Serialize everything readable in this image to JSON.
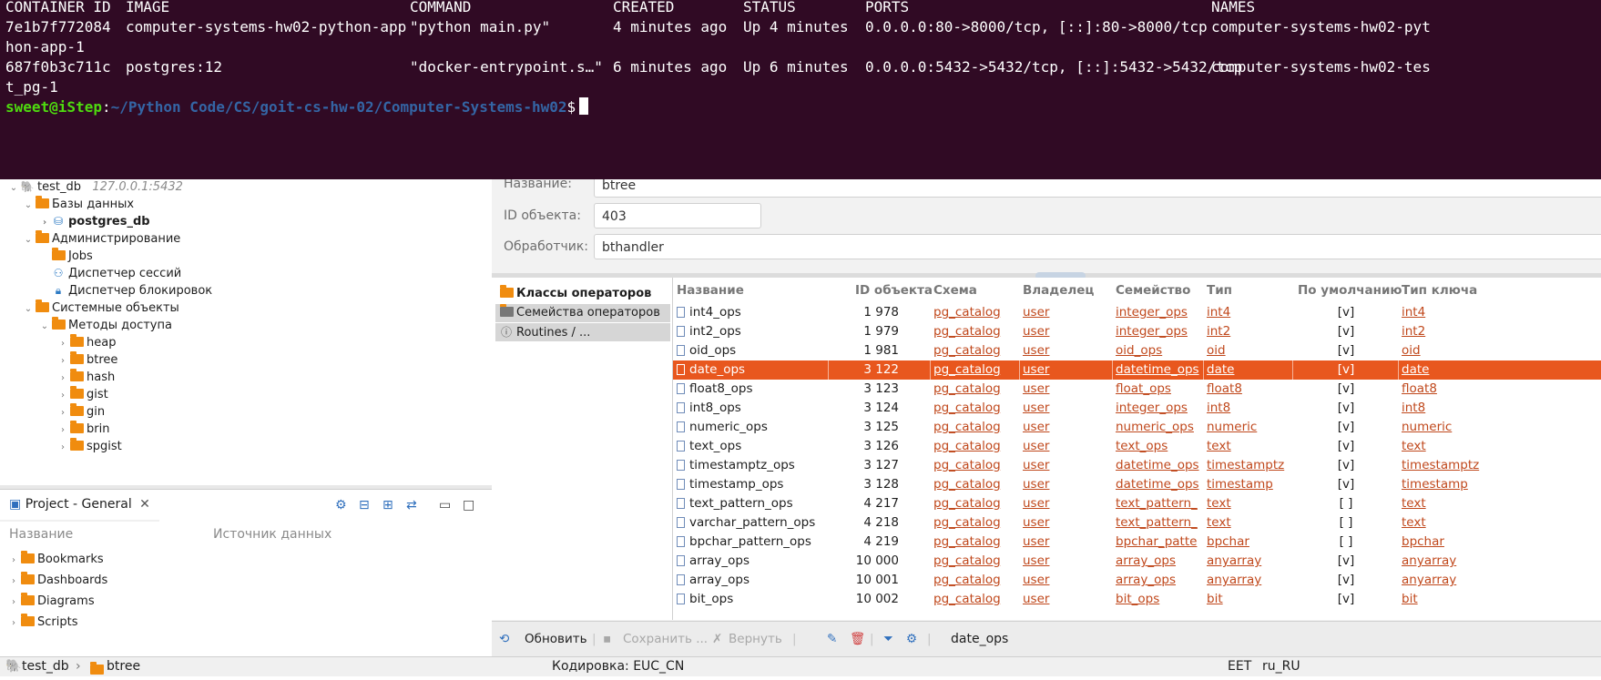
{
  "terminal": {
    "headers": {
      "container_id": "CONTAINER ID",
      "image": "IMAGE",
      "command": "COMMAND",
      "created": "CREATED",
      "status": "STATUS",
      "ports": "PORTS",
      "names": "NAMES"
    },
    "rows": [
      {
        "container_id": "7e1b7f772084",
        "image": "computer-systems-hw02-python-app",
        "command": "\"python main.py\"",
        "created": "4 minutes ago",
        "status": "Up 4 minutes",
        "ports": "0.0.0.0:80->8000/tcp, [::]:80->8000/tcp",
        "names": "computer-systems-hw02-pyt",
        "wrap": "hon-app-1"
      },
      {
        "container_id": "687f0b3c711c",
        "image": "postgres:12",
        "command": "\"docker-entrypoint.s…\"",
        "created": "6 minutes ago",
        "status": "Up 6 minutes",
        "ports": "0.0.0.0:5432->5432/tcp, [::]:5432->5432/tcp",
        "names": "computer-systems-hw02-tes",
        "wrap": "t_pg-1"
      }
    ],
    "prompt_user": "sweet@iStep",
    "prompt_sep": ":",
    "prompt_path": "~/Python Code/CS/goit-cs-hw-02/Computer-Systems-hw02",
    "prompt_dollar": "$"
  },
  "navigator": {
    "connection": {
      "name": "test_db",
      "host": "127.0.0.1:5432"
    },
    "databases_label": "Базы данных",
    "database": "postgres_db",
    "admin_label": "Администрирование",
    "admin_items": [
      "Jobs",
      "Диспетчер сессий",
      "Диспетчер блокировок"
    ],
    "system_objects": "Системные объекты",
    "access_methods": "Методы доступа",
    "methods": [
      "heap",
      "btree",
      "hash",
      "gist",
      "gin",
      "brin",
      "spgist"
    ]
  },
  "project": {
    "tab_label": "Project - General",
    "col_name": "Название",
    "col_source": "Источник данных",
    "items": [
      "Bookmarks",
      "Dashboards",
      "Diagrams",
      "Scripts"
    ]
  },
  "editor": {
    "name_label": "Название:",
    "name_value": "btree",
    "id_label": "ID объекта:",
    "id_value": "403",
    "handler_label": "Обработчик:",
    "handler_value": "bthandler",
    "tabs": [
      "Классы операторов",
      "Семейства операторов",
      "Routines / ..."
    ],
    "columns": [
      "Название",
      "ID объекта",
      "Схема",
      "Владелец",
      "Семейство",
      "Тип",
      "По умолчанию",
      "Тип ключа"
    ],
    "rows": [
      {
        "name": "int4_ops",
        "id": "1 978",
        "schema": "pg_catalog",
        "owner": "user",
        "family": "integer_ops",
        "type": "int4",
        "default": "[v]",
        "key": "int4"
      },
      {
        "name": "int2_ops",
        "id": "1 979",
        "schema": "pg_catalog",
        "owner": "user",
        "family": "integer_ops",
        "type": "int2",
        "default": "[v]",
        "key": "int2"
      },
      {
        "name": "oid_ops",
        "id": "1 981",
        "schema": "pg_catalog",
        "owner": "user",
        "family": "oid_ops",
        "type": "oid",
        "default": "[v]",
        "key": "oid"
      },
      {
        "name": "date_ops",
        "id": "3 122",
        "schema": "pg_catalog",
        "owner": "user",
        "family": "datetime_ops",
        "type": "date",
        "default": "[v]",
        "key": "date"
      },
      {
        "name": "float8_ops",
        "id": "3 123",
        "schema": "pg_catalog",
        "owner": "user",
        "family": "float_ops",
        "type": "float8",
        "default": "[v]",
        "key": "float8"
      },
      {
        "name": "int8_ops",
        "id": "3 124",
        "schema": "pg_catalog",
        "owner": "user",
        "family": "integer_ops",
        "type": "int8",
        "default": "[v]",
        "key": "int8"
      },
      {
        "name": "numeric_ops",
        "id": "3 125",
        "schema": "pg_catalog",
        "owner": "user",
        "family": "numeric_ops",
        "type": "numeric",
        "default": "[v]",
        "key": "numeric"
      },
      {
        "name": "text_ops",
        "id": "3 126",
        "schema": "pg_catalog",
        "owner": "user",
        "family": "text_ops",
        "type": "text",
        "default": "[v]",
        "key": "text"
      },
      {
        "name": "timestamptz_ops",
        "id": "3 127",
        "schema": "pg_catalog",
        "owner": "user",
        "family": "datetime_ops",
        "type": "timestamptz",
        "default": "[v]",
        "key": "timestamptz"
      },
      {
        "name": "timestamp_ops",
        "id": "3 128",
        "schema": "pg_catalog",
        "owner": "user",
        "family": "datetime_ops",
        "type": "timestamp",
        "default": "[v]",
        "key": "timestamp"
      },
      {
        "name": "text_pattern_ops",
        "id": "4 217",
        "schema": "pg_catalog",
        "owner": "user",
        "family": "text_pattern_",
        "type": "text",
        "default": "[ ]",
        "key": "text"
      },
      {
        "name": "varchar_pattern_ops",
        "id": "4 218",
        "schema": "pg_catalog",
        "owner": "user",
        "family": "text_pattern_",
        "type": "text",
        "default": "[ ]",
        "key": "text"
      },
      {
        "name": "bpchar_pattern_ops",
        "id": "4 219",
        "schema": "pg_catalog",
        "owner": "user",
        "family": "bpchar_patte",
        "type": "bpchar",
        "default": "[ ]",
        "key": "bpchar"
      },
      {
        "name": "array_ops",
        "id": "10 000",
        "schema": "pg_catalog",
        "owner": "user",
        "family": "array_ops",
        "type": "anyarray",
        "default": "[v]",
        "key": "anyarray"
      },
      {
        "name": "array_ops",
        "id": "10 001",
        "schema": "pg_catalog",
        "owner": "user",
        "family": "array_ops",
        "type": "anyarray",
        "default": "[v]",
        "key": "anyarray"
      },
      {
        "name": "bit_ops",
        "id": "10 002",
        "schema": "pg_catalog",
        "owner": "user",
        "family": "bit_ops",
        "type": "bit",
        "default": "[v]",
        "key": "bit"
      }
    ],
    "selected_row": 3,
    "refresh_label": "Обновить",
    "save_label": "Сохранить ...",
    "revert_label": "Вернуть",
    "selected_value": "date_ops"
  },
  "statusbar": {
    "crumb_db": "test_db",
    "crumb_obj": "btree",
    "encoding": "Кодировка: EUC_CN",
    "timezone": "EET",
    "locale": "ru_RU"
  },
  "colors": {
    "terminal_bg": "#300a24",
    "selection": "#e8571e",
    "link": "#c0481c",
    "folder": "#f08c0f"
  }
}
